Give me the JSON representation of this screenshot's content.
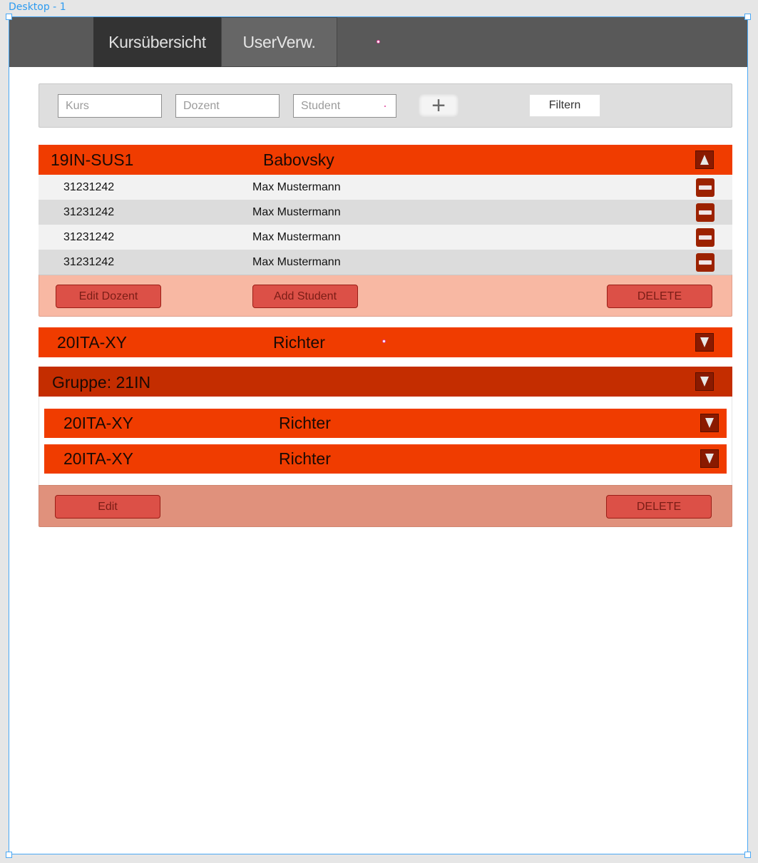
{
  "artboard": {
    "label": "Desktop - 1"
  },
  "nav": {
    "tabs": [
      {
        "label": "Kursübersicht",
        "active": true
      },
      {
        "label": "UserVerw.",
        "active": false
      }
    ]
  },
  "filter": {
    "kurs_placeholder": "Kurs",
    "dozent_placeholder": "Dozent",
    "student_placeholder": "Student",
    "add_label": "+",
    "filter_label": "Filtern"
  },
  "course_expanded": {
    "code": "19IN-SUS1",
    "dozent": "Babovsky",
    "toggle_icon": "triangle-up-icon",
    "students": [
      {
        "id": "31231242",
        "name": "Max Mustermann"
      },
      {
        "id": "31231242",
        "name": "Max Mustermann"
      },
      {
        "id": "31231242",
        "name": "Max Mustermann"
      },
      {
        "id": "31231242",
        "name": "Max Mustermann"
      }
    ],
    "actions": {
      "edit_dozent": "Edit Dozent",
      "add_student": "Add Student",
      "delete": "DELETE"
    }
  },
  "course_collapsed": {
    "code": "20ITA-XY",
    "dozent": "Richter",
    "toggle_icon": "triangle-down-icon"
  },
  "group": {
    "title": "Gruppe: 21IN",
    "toggle_icon": "triangle-down-icon",
    "courses": [
      {
        "code": "20ITA-XY",
        "dozent": "Richter"
      },
      {
        "code": "20ITA-XY",
        "dozent": "Richter"
      }
    ],
    "actions": {
      "edit": "Edit",
      "delete": "DELETE"
    }
  },
  "colors": {
    "accent": "#f03c00",
    "group_header": "#c42d00",
    "nav_bg": "#595959",
    "footer_bg": "#f8b8a3"
  }
}
